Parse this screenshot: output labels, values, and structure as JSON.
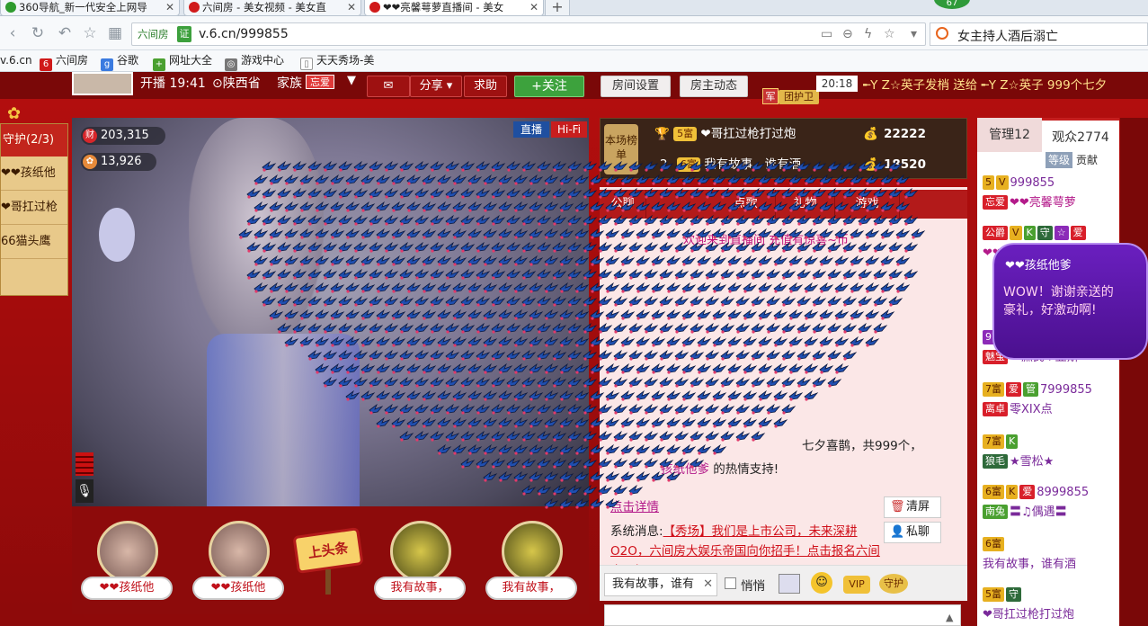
{
  "browser": {
    "tabs": [
      {
        "title": "360导航_新一代安全上网导",
        "icon_color": "#2e9b2e"
      },
      {
        "title": "六间房 - 美女视频 - 美女直",
        "icon_color": "#d01a1a"
      },
      {
        "title": "❤❤亮馨萼萝直播间 - 美女",
        "icon_color": "#d01a1a",
        "active": true
      }
    ],
    "new_tab_label": "+",
    "address": {
      "site_label": "六间房",
      "cert_label": "证",
      "url": "v.6.cn/999855"
    },
    "search": {
      "value": "女主持人酒后溺亡"
    },
    "bookmarks": [
      "v.6.cn",
      "六间房",
      "谷歌",
      "网址大全",
      "游戏中心",
      "天天秀场-美"
    ],
    "badge": "67"
  },
  "room": {
    "live_time": "开播 19:41",
    "location": "陕西省",
    "family_label": "家族",
    "family_badge": "忘爱",
    "share_label": "分享",
    "help_label": "求助",
    "follow_label": "+关注",
    "room_settings_label": "房间设置",
    "host_news_label": "房主动态",
    "guard_badge": "团护卫",
    "army_badge": "军",
    "gift_broadcast": {
      "time": "20:18",
      "text": "╾Y Z☆英子发梢 送给 ╾Y Z☆英子 999个七夕"
    }
  },
  "guard": {
    "header": "守护(2/3)",
    "items": [
      "❤❤孩纸他",
      "❤哥扛过枪",
      "66猫头鹰"
    ]
  },
  "video": {
    "live_tag": "直播",
    "quality_tag": "Hi-Fi",
    "wealth_icon": "财",
    "wealth_value": "203,315",
    "flower_value": "13,926"
  },
  "seats": [
    {
      "name": "❤❤孩纸他",
      "kind": "person"
    },
    {
      "name": "❤❤孩纸他",
      "kind": "person"
    },
    {
      "name": "上头条",
      "kind": "headline"
    },
    {
      "name": "我有故事，",
      "kind": "car"
    },
    {
      "name": "我有故事，",
      "kind": "car"
    }
  ],
  "rank": {
    "label": "本场榜单",
    "rows": [
      {
        "pos": "1",
        "level": "5富",
        "name": "❤哥扛过枪打过炮",
        "value": "22222"
      },
      {
        "pos": "2",
        "level": "6富",
        "name": "我有故事，谁有酒",
        "value": "18520"
      }
    ]
  },
  "chat": {
    "tabs": [
      "公聊",
      "点歌",
      "礼物",
      "游戏"
    ],
    "top_notice": "欢迎来到直播间 充值有惊喜~币",
    "gift_message": "七夕喜鹊，共999个，",
    "thanks_user": "孩纸他爹",
    "thanks_suffix": "的热情支持!",
    "click_detail": "点击详情",
    "clear_label": "清屏",
    "private_label": "私聊",
    "system_prefix": "系统消息:",
    "system_link": "【秀场】我们是上市公司，未来深耕O2O，六间房大娱乐帝国向你招手！点击报名六间房星探！",
    "input_target": "我有故事，谁有",
    "quiet_label": "悄悄",
    "vip_label": "VIP",
    "guard_label": "守护"
  },
  "audience": {
    "admin_tab": "管理12",
    "viewers_tab": "观众2774",
    "level_label": "等级",
    "contrib_label": "贡献",
    "users": [
      {
        "id": "999855",
        "name": "❤❤亮馨萼萝",
        "badges": [
          "5",
          "V"
        ],
        "tag": "忘爱"
      },
      {
        "id": "",
        "name": "❤❤孩纸他爹",
        "badges": [
          "公爵",
          "V",
          "K",
          "守",
          "☆",
          "爱"
        ],
        "tag": ""
      },
      {
        "id": "5551127",
        "name": "︶庶民♥亚斯",
        "badges": [
          "9富"
        ],
        "tag": "魅宝"
      },
      {
        "id": "7999855",
        "name": "零XIX点",
        "badges": [
          "7富",
          "爱",
          "管"
        ],
        "tag": "离卓"
      },
      {
        "id": "",
        "name": "★雪松★",
        "badges": [
          "7富",
          "K"
        ],
        "tag": "狼毛"
      },
      {
        "id": "8999855",
        "name": "〓♫偶遇〓",
        "badges": [
          "6富",
          "K",
          "爱"
        ],
        "tag": "南兔"
      },
      {
        "id": "",
        "name": "我有故事，谁有酒",
        "badges": [
          "6富"
        ],
        "tag": ""
      },
      {
        "id": "",
        "name": "❤哥扛过枪打过炮",
        "badges": [
          "5富",
          "守"
        ],
        "tag": ""
      }
    ]
  },
  "bubble": {
    "user": "❤❤孩纸他爹",
    "line1": "WOW！谢谢亲送的",
    "line2": "豪礼，好激动啊!"
  },
  "colors": {
    "accent_red": "#b31a1a",
    "follow_green": "#3da23d",
    "gift_blue": "#1f4fb0"
  }
}
